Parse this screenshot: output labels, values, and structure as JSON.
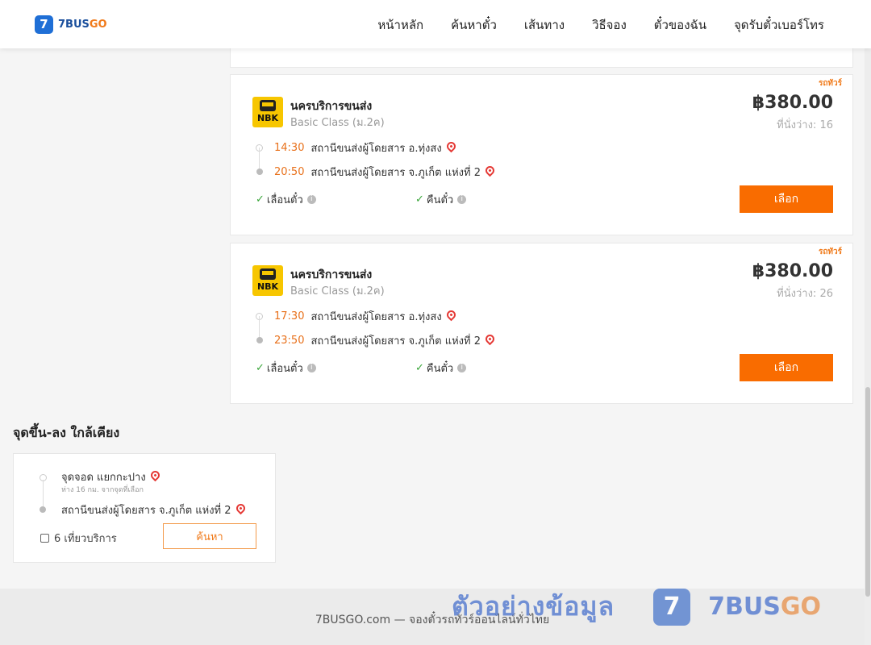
{
  "header": {
    "logo_mark": "7",
    "logo_text_main": "7BUS",
    "logo_text_accent": "GO",
    "nav": [
      "หน้าหลัก",
      "ค้นหาตั๋ว",
      "เส้นทาง",
      "วิธีจอง",
      "ตั๋วของฉัน",
      "จุดรับตั๋วเบอร์โทร"
    ]
  },
  "trips": [
    {
      "tag": "รถทัวร์",
      "operator": "นครบริการขนส่ง",
      "operator_logo_text": "NBK",
      "bus_class": "Basic Class (ม.2ค)",
      "price": "฿380.00",
      "seats_label": "ที่นั่งว่าง:",
      "seats_value": "16",
      "depart_time": "14:30",
      "depart_station": "สถานีขนส่งผู้โดยสาร อ.ทุ่งสง",
      "arrive_time": "20:50",
      "arrive_station": "สถานีขนส่งผู้โดยสาร จ.ภูเก็ต แห่งที่ 2",
      "feature_a": "เลื่อนตั๋ว",
      "feature_b": "คืนตั๋ว",
      "select_label": "เลือก"
    },
    {
      "tag": "รถทัวร์",
      "operator": "นครบริการขนส่ง",
      "operator_logo_text": "NBK",
      "bus_class": "Basic Class (ม.2ค)",
      "price": "฿380.00",
      "seats_label": "ที่นั่งว่าง:",
      "seats_value": "26",
      "depart_time": "17:30",
      "depart_station": "สถานีขนส่งผู้โดยสาร อ.ทุ่งสง",
      "arrive_time": "23:50",
      "arrive_station": "สถานีขนส่งผู้โดยสาร จ.ภูเก็ต แห่งที่ 2",
      "feature_a": "เลื่อนตั๋ว",
      "feature_b": "คืนตั๋ว",
      "select_label": "เลือก"
    }
  ],
  "nearby": {
    "title": "จุดขึ้น-ลง ใกล้เคียง",
    "from_stop": "จุดจอด แยกกะปาง",
    "distance_note": "ห่าง 16 กม. จากจุดที่เลือก",
    "to_stop": "สถานีขนส่งผู้โดยสาร จ.ภูเก็ต แห่งที่ 2",
    "trips_count": "6 เที่ยวบริการ",
    "search_label": "ค้นหา"
  },
  "footer": {
    "text": "7BUSGO.com — จองตั๋วรถทัวร์ออนไลน์ทั่วไทย"
  },
  "watermark": {
    "text": "ตัวอย่างข้อมูล",
    "badge": "7",
    "brand_main": "7BUS",
    "brand_accent": "GO"
  },
  "colors": {
    "accent": "#f96c00",
    "time": "#e8701a",
    "brand_blue": "#1f6fd6",
    "check": "#3aa63a",
    "pin": "#e53935"
  },
  "icons": [
    "bus-logo-icon",
    "map-pin-icon",
    "check-icon",
    "info-icon",
    "bus-icon"
  ]
}
